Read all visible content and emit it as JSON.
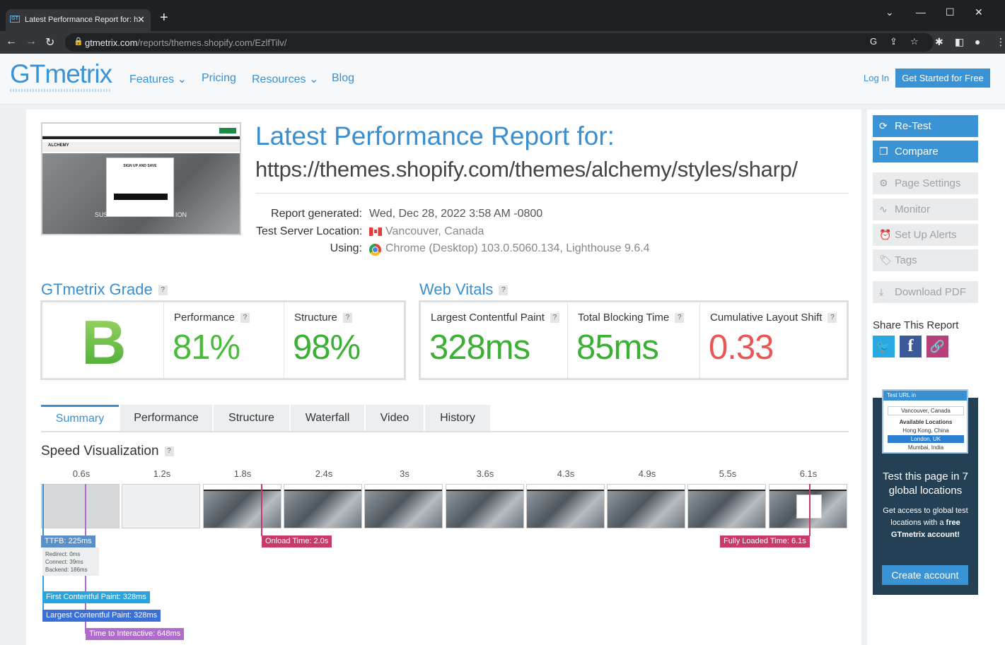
{
  "browser": {
    "tab_title": "Latest Performance Report for: ht",
    "tab_favicon": "GT",
    "url_domain": "gtmetrix.com",
    "url_path": "/reports/themes.shopify.com/EzlfTilv/"
  },
  "header": {
    "logo": "GTmetrix",
    "nav": [
      "Features",
      "Pricing",
      "Resources",
      "Blog"
    ],
    "login": "Log In",
    "cta": "Get Started for Free"
  },
  "report": {
    "title": "Latest Performance Report for:",
    "url": "https://themes.shopify.com/themes/alchemy/styles/sharp/",
    "meta": [
      {
        "label": "Report generated:",
        "value": "Wed, Dec 28, 2022 3:58 AM -0800"
      },
      {
        "label": "Test Server Location:",
        "value": "Vancouver, Canada"
      },
      {
        "label": "Using:",
        "value": "Chrome (Desktop) 103.0.5060.134, Lighthouse 9.6.4"
      }
    ],
    "thumb": {
      "logo": "ALCHEMY",
      "modal_title": "SIGN UP AND SAVE",
      "hero_text": "SUS",
      "hero_text2": "ION"
    }
  },
  "grade": {
    "heading": "GTmetrix Grade",
    "letter": "B",
    "performance_label": "Performance",
    "performance": "81%",
    "structure_label": "Structure",
    "structure": "98%"
  },
  "vitals": {
    "heading": "Web Vitals",
    "lcp_label": "Largest Contentful Paint",
    "lcp": "328ms",
    "tbt_label": "Total Blocking Time",
    "tbt": "85ms",
    "cls_label": "Cumulative Layout Shift",
    "cls": "0.33"
  },
  "tabs": [
    "Summary",
    "Performance",
    "Structure",
    "Waterfall",
    "Video",
    "History"
  ],
  "speed": {
    "heading": "Speed Visualization",
    "times": [
      "0.6s",
      "1.2s",
      "1.8s",
      "2.4s",
      "3s",
      "3.6s",
      "4.3s",
      "4.9s",
      "5.5s",
      "6.1s"
    ],
    "markers": {
      "ttfb": "TTFB: 225ms",
      "redirect": "Redirect: 0ms",
      "connect": "Connect: 39ms",
      "backend": "Backend: 186ms",
      "onload": "Onload Time: 2.0s",
      "fully_loaded": "Fully Loaded Time: 6.1s",
      "fcp": "First Contentful Paint: 328ms",
      "lcp": "Largest Contentful Paint: 328ms",
      "tti": "Time to Interactive: 648ms"
    }
  },
  "sidebar": {
    "retest": "Re-Test",
    "compare": "Compare",
    "page_settings": "Page Settings",
    "monitor": "Monitor",
    "alerts": "Set Up Alerts",
    "tags": "Tags",
    "download": "Download PDF",
    "share_heading": "Share This Report",
    "promo": {
      "shot_head": "Test URL in",
      "shot_current": "Vancouver, Canada",
      "shot_available": "Available Locations",
      "shot_locs": [
        "Hong Kong, China",
        "London, UK",
        "Mumbai, India"
      ],
      "heading": "Test this page in 7 global locations",
      "body_pre": "Get access to global test locations with a",
      "body_bold": "free GTmetrix account!",
      "button": "Create account"
    }
  },
  "colors": {
    "brand": "#3a93d4",
    "good": "#3cb035",
    "bad": "#ea5656",
    "onload": "#c73a6b",
    "fcp": "#2aa4de",
    "lcp_marker": "#3a6fd8",
    "tti": "#b06ccc"
  }
}
